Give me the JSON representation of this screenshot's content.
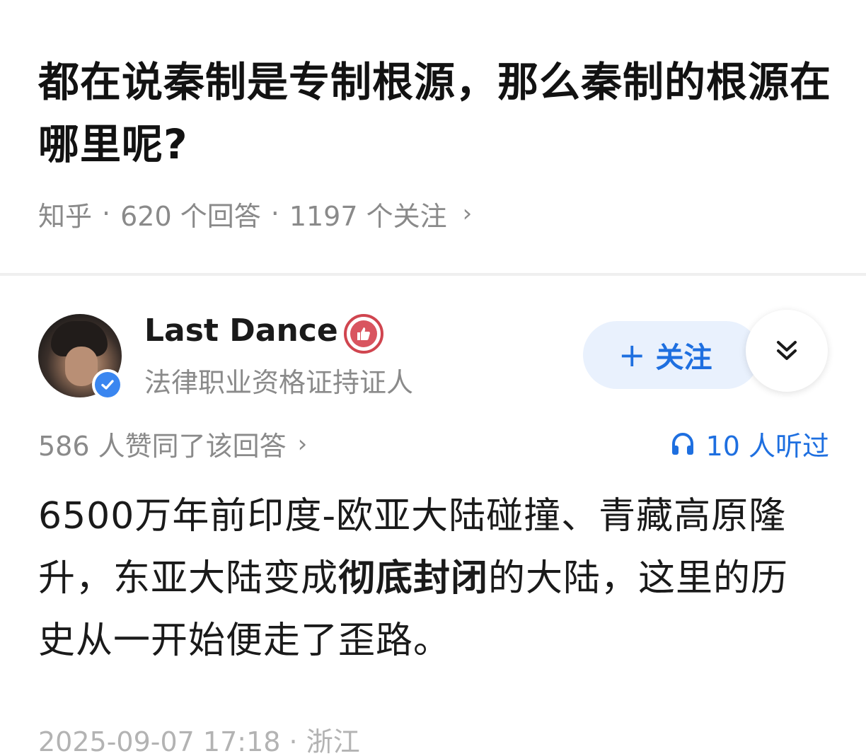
{
  "question": {
    "title": "都在说秦制是专制根源，那么秦制的根源在哪里呢?",
    "source": "知乎",
    "answers": "620 个回答",
    "followers": "1197 个关注"
  },
  "author": {
    "name": "Last Dance",
    "headline": "法律职业资格证持证人",
    "avatar_icon": "avatar-photo",
    "verified_icon": "verified-check-icon",
    "badge_icon": "thumbs-up-badge-icon"
  },
  "actions": {
    "follow_label": "关注",
    "expand_icon": "double-chevron-down-icon"
  },
  "stats": {
    "agree": "586 人赞同了该回答",
    "listen": "10 人听过"
  },
  "answer": {
    "part1": "6500万年前印度-欧亚大陆碰撞、青藏高原隆升，东亚大陆变成",
    "bold": "彻底封闭",
    "part2": "的大陆，这里的历史从一开始便走了歪路。"
  },
  "footer": {
    "timestamp": "2025-09-07 17:18",
    "location": "浙江"
  },
  "colors": {
    "accent": "#1e6fe0",
    "follow_bg": "#e9f1fd",
    "meta_text": "#8a8a8a",
    "badge_red": "#d0454f"
  }
}
